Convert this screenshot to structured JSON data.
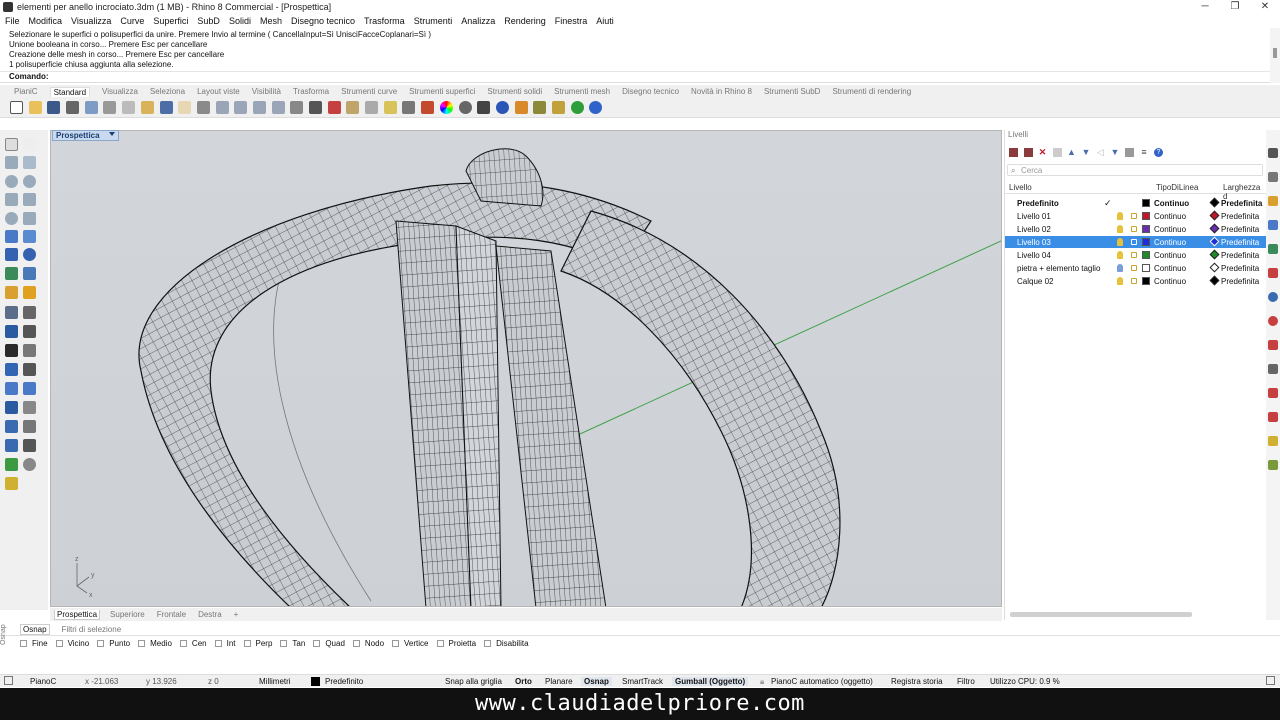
{
  "window": {
    "title": "elementi per anello incrociato.3dm (1 MB) - Rhino 8 Commercial - [Prospettica]",
    "minimize": "─",
    "maximize": "❐",
    "close": "✕"
  },
  "menu": [
    "File",
    "Modifica",
    "Visualizza",
    "Curve",
    "Superfici",
    "SubD",
    "Solidi",
    "Mesh",
    "Disegno tecnico",
    "Trasforma",
    "Strumenti",
    "Analizza",
    "Rendering",
    "Finestra",
    "Aiuti"
  ],
  "command_history": [
    "Selezionare le superfici o polisuperfici da unire. Premere Invio al termine ( CancellaInput=Sì  UnisciFacceCoplanari=Sì )",
    "Unione booleana in corso... Premere Esc per cancellare",
    "Creazione delle mesh in corso... Premere Esc per cancellare",
    "1 polisuperficie chiusa aggiunta alla selezione."
  ],
  "command_prompt": "Comando:",
  "toolbar_tabs": [
    "PianiC",
    "Standard",
    "Visualizza",
    "Seleziona",
    "Layout viste",
    "Visibilità",
    "Trasforma",
    "Strumenti curve",
    "Strumenti superfici",
    "Strumenti solidi",
    "Strumenti mesh",
    "Disegno tecnico",
    "Novità in Rhino 8",
    "Strumenti SubD",
    "Strumenti di rendering"
  ],
  "active_toolbar_tab": "Standard",
  "viewport": {
    "name": "Prospettica",
    "axis_labels": [
      "z",
      "y",
      "x"
    ]
  },
  "viewport_tabs": [
    "Prospettica",
    "Superiore",
    "Frontale",
    "Destra",
    "+"
  ],
  "layers_panel": {
    "title": "Livelli",
    "search_placeholder": "Cerca",
    "columns": [
      "Livello",
      "TipoDiLinea",
      "Larghezza d"
    ],
    "rows": [
      {
        "name": "Predefinito",
        "linetype": "Continuo",
        "width": "Predefinita",
        "color": "#000000",
        "current": true,
        "bold": true
      },
      {
        "name": "Livello 01",
        "linetype": "Continuo",
        "width": "Predefinita",
        "color": "#c0182a"
      },
      {
        "name": "Livello 02",
        "linetype": "Continuo",
        "width": "Predefinita",
        "color": "#6a2fb0"
      },
      {
        "name": "Livello 03",
        "linetype": "Continuo",
        "width": "Predefinita",
        "color": "#1c2fd8",
        "selected": true
      },
      {
        "name": "Livello 04",
        "linetype": "Continuo",
        "width": "Predefinita",
        "color": "#1f8a2a"
      },
      {
        "name": "pietra + elemento taglio",
        "linetype": "Continuo",
        "width": "Predefinita",
        "color": "#ffffff"
      },
      {
        "name": "Calque 02",
        "linetype": "Continuo",
        "width": "Predefinita",
        "color": "#000000"
      }
    ]
  },
  "osnap_tabs": [
    "Osnap",
    "Filtri di selezione"
  ],
  "osnap_side_label": "Osnap",
  "osnap_items": [
    "Fine",
    "Vicino",
    "Punto",
    "Medio",
    "Cen",
    "Int",
    "Perp",
    "Tan",
    "Quad",
    "Nodo",
    "Vertice",
    "Proietta",
    "Disabilita"
  ],
  "status": {
    "cplane": "PianoC",
    "x": "x -21.063",
    "y": "y 13.926",
    "z": "z 0",
    "units": "Millimetri",
    "layer": "Predefinito",
    "snap_grid": "Snap alla griglia",
    "ortho": "Orto",
    "planar": "Planare",
    "osnap": "Osnap",
    "smarttrack": "SmartTrack",
    "gumball": "Gumball (Oggetto)",
    "auto_cplane": "PianoC automatico (oggetto)",
    "history": "Registra storia",
    "filter": "Filtro",
    "cpu": "Utilizzo CPU: 0.9 %"
  },
  "watermark": "www.claudiadelpriore.com",
  "colors": {
    "accent": "#3a8ee6",
    "viewport_bg": "#cfd3d7",
    "viewport_tab": "#c9d9ef"
  }
}
